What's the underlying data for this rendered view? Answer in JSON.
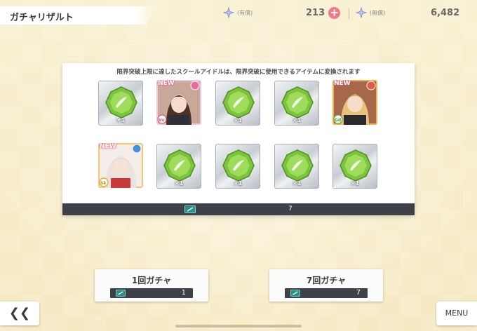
{
  "header": {
    "title": "ガチャリザルト",
    "paid_label": "(有償)",
    "paid_value": "213",
    "free_label": "(無償)",
    "free_value": "6,482",
    "plus": "+"
  },
  "panel": {
    "note": "限界突破上限に達したスクールアイドルは、限界突破に使用できるアイテムに変換されます",
    "items": [
      {
        "type": "crystal",
        "qty": "×1"
      },
      {
        "type": "idol",
        "new": "NEW",
        "attribute": "Vo"
      },
      {
        "type": "crystal",
        "qty": "×1"
      },
      {
        "type": "crystal",
        "qty": "×1"
      },
      {
        "type": "idol",
        "new": "NEW",
        "attribute": "Gd"
      },
      {
        "type": "idol",
        "new": "NEW",
        "attribute": "Sk"
      },
      {
        "type": "crystal",
        "qty": "×1"
      },
      {
        "type": "crystal",
        "qty": "×1"
      },
      {
        "type": "crystal",
        "qty": "×1"
      },
      {
        "type": "crystal",
        "qty": "×1"
      }
    ],
    "ticket_count": "7"
  },
  "buttons": {
    "single_label": "1回ガチャ",
    "single_cost": "1",
    "multi_label": "7回ガチャ",
    "multi_cost": "7",
    "back": "❮❮",
    "menu": "MENU"
  },
  "colors": {
    "background": "#f7eec9",
    "footer_bar": "#3e4148",
    "plus_button": "#f07a8a",
    "crystal_green": "#7cc43c"
  }
}
